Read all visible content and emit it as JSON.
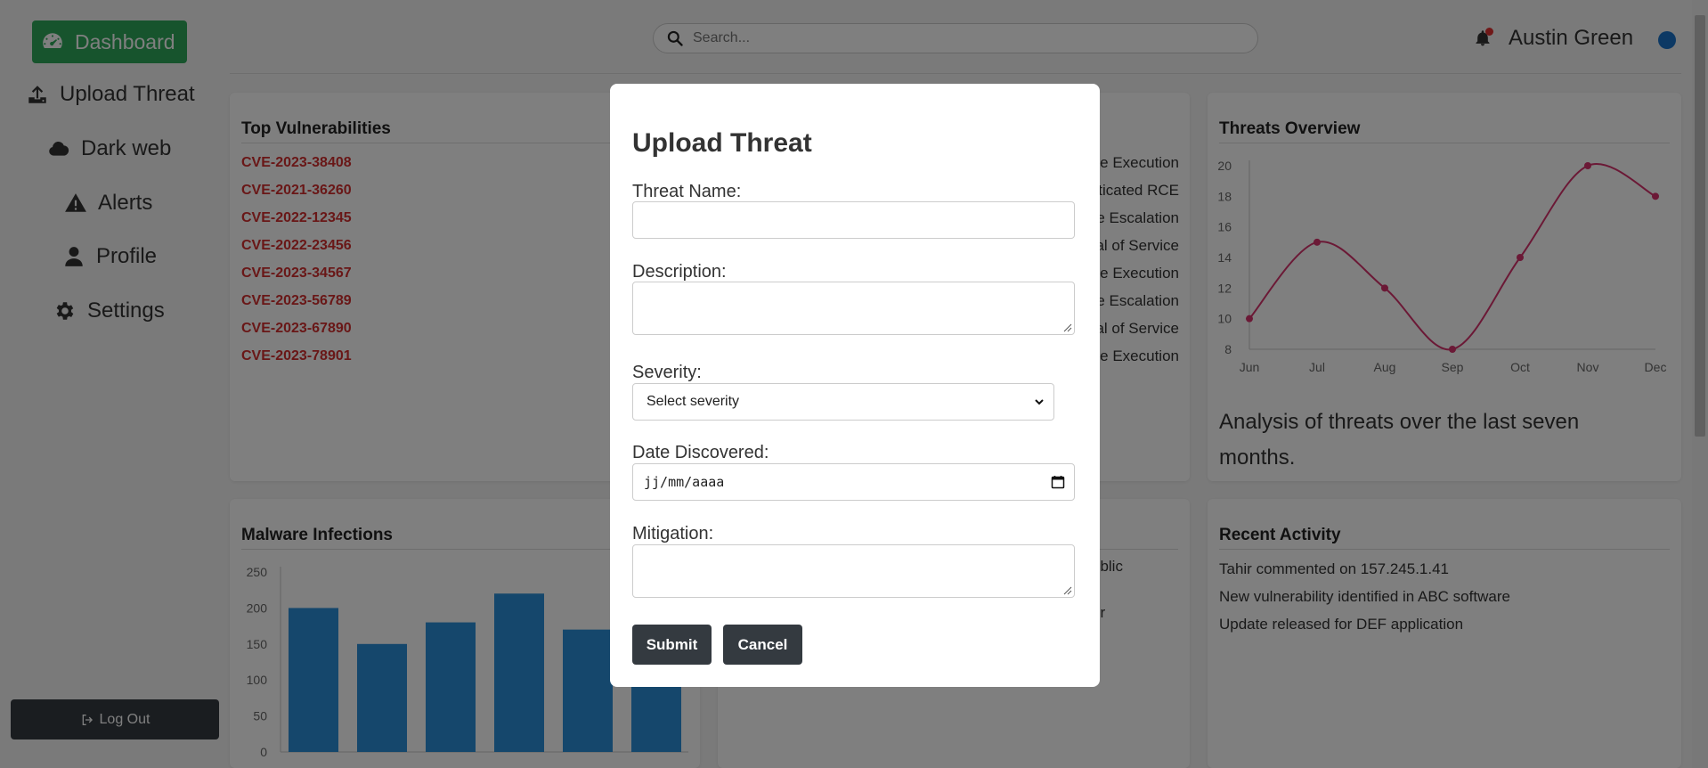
{
  "sidebar": {
    "dashboard_label": "Dashboard",
    "items": [
      {
        "label": "Upload Threat",
        "icon": "upload-icon"
      },
      {
        "label": "Dark web",
        "icon": "cloud-icon"
      },
      {
        "label": "Alerts",
        "icon": "warning-icon"
      },
      {
        "label": "Profile",
        "icon": "user-icon"
      },
      {
        "label": "Settings",
        "icon": "gear-icon"
      }
    ],
    "logout_label": "Log Out",
    "accent": "#2ea85a"
  },
  "header": {
    "search_placeholder": "Search...",
    "user_name": "Austin Green",
    "notification_dot_color": "#e03131",
    "status_dot_color": "#1a73c9"
  },
  "cards": {
    "top_vulnerabilities": {
      "title": "Top Vulnerabilities",
      "items": [
        "CVE-2023-38408",
        "CVE-2021-36260",
        "CVE-2022-12345",
        "CVE-2022-23456",
        "CVE-2023-34567",
        "CVE-2023-56789",
        "CVE-2023-67890",
        "CVE-2023-78901"
      ],
      "color": "#d32f2f"
    },
    "middle_partial": {
      "items": [
        "e Execution",
        "ticated RCE",
        "e Escalation",
        "al of Service",
        "e Execution",
        "e Escalation",
        "al of Service",
        "e Execution"
      ],
      "lower_items": [
        "ublic",
        "or"
      ]
    },
    "threats_overview": {
      "title": "Threats Overview",
      "caption": "Analysis of threats over the last seven months."
    },
    "malware_infections": {
      "title": "Malware Infections"
    },
    "recent_activity": {
      "title": "Recent Activity",
      "items": [
        "Tahir commented on 157.245.1.41",
        "New vulnerability identified in ABC software",
        "Update released for DEF application"
      ]
    }
  },
  "chart_data": [
    {
      "type": "line",
      "title": "Threats Overview",
      "categories": [
        "Jun",
        "Jul",
        "Aug",
        "Sep",
        "Oct",
        "Nov",
        "Dec"
      ],
      "values": [
        10,
        15,
        12,
        8,
        14,
        20,
        18
      ],
      "ylim": [
        8,
        20
      ],
      "yticks": [
        8,
        10,
        12,
        14,
        16,
        18,
        20
      ],
      "color": "#d6336c",
      "grid": false
    },
    {
      "type": "bar",
      "title": "Malware Infections",
      "values": [
        200,
        150,
        180,
        220,
        170,
        140
      ],
      "ylim": [
        0,
        250
      ],
      "yticks": [
        0,
        50,
        100,
        150,
        200,
        250
      ],
      "color": "#2b8fd9",
      "grid": false
    }
  ],
  "modal": {
    "title": "Upload Threat",
    "threat_name_label": "Threat Name:",
    "description_label": "Description:",
    "severity_label": "Severity:",
    "severity_value": "Select severity",
    "date_label": "Date Discovered:",
    "date_placeholder": "jj/mm/aaaa",
    "mitigation_label": "Mitigation:",
    "submit_label": "Submit",
    "cancel_label": "Cancel"
  }
}
